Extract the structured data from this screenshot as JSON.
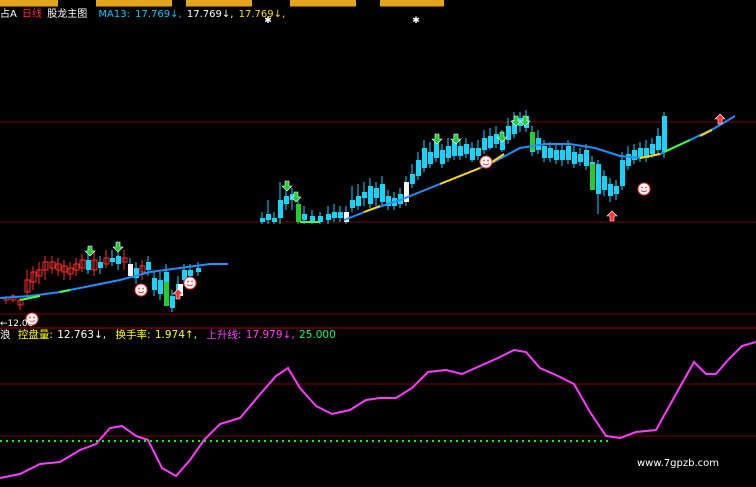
{
  "colors": {
    "up": "#ff2a2a",
    "down": "#17d3ff",
    "ma": "#1e90ff",
    "ma_alt": "#ffd700",
    "sub_line": "#ff3cff",
    "dotted": "#00ff00",
    "grid": "#7a0000",
    "text_cyan": "#00c8ff",
    "text_yellow": "#ffff00",
    "text_magenta": "#ff40ff",
    "text_white": "#ffffff"
  },
  "header": {
    "prefix": "占A",
    "period": "日线",
    "indicator": "股龙主图",
    "ma_label": "MA13:",
    "ma_values": [
      "17.769↓,",
      "17.769↓,",
      "17.769↓,"
    ]
  },
  "sub_header": {
    "prefix": "浪",
    "label1": "控盘量:",
    "value1": "12.763↓,",
    "label2": "换手率:",
    "value2": "1.974↑,",
    "label3": "上升线:",
    "value3": "17.979↓,",
    "value4": "25.000"
  },
  "price_marker": "←12.08",
  "watermark": "www.7gpzb.com",
  "chart_data": [
    {
      "type": "candlestick",
      "title": "股龙主图",
      "series": [
        {
          "name": "MA13",
          "value": 17.769
        }
      ],
      "trend": "stepped uptrend with gaps; candles colored by up/down, MA line blue/yellow"
    },
    {
      "type": "line",
      "series": [
        {
          "name": "控盘量",
          "last_value": 12.763
        },
        {
          "name": "换手率",
          "last_value": 1.974
        },
        {
          "name": "上升线",
          "last_value": 17.979
        },
        {
          "name": "reference",
          "value": 25.0,
          "style": "dotted"
        }
      ]
    }
  ]
}
